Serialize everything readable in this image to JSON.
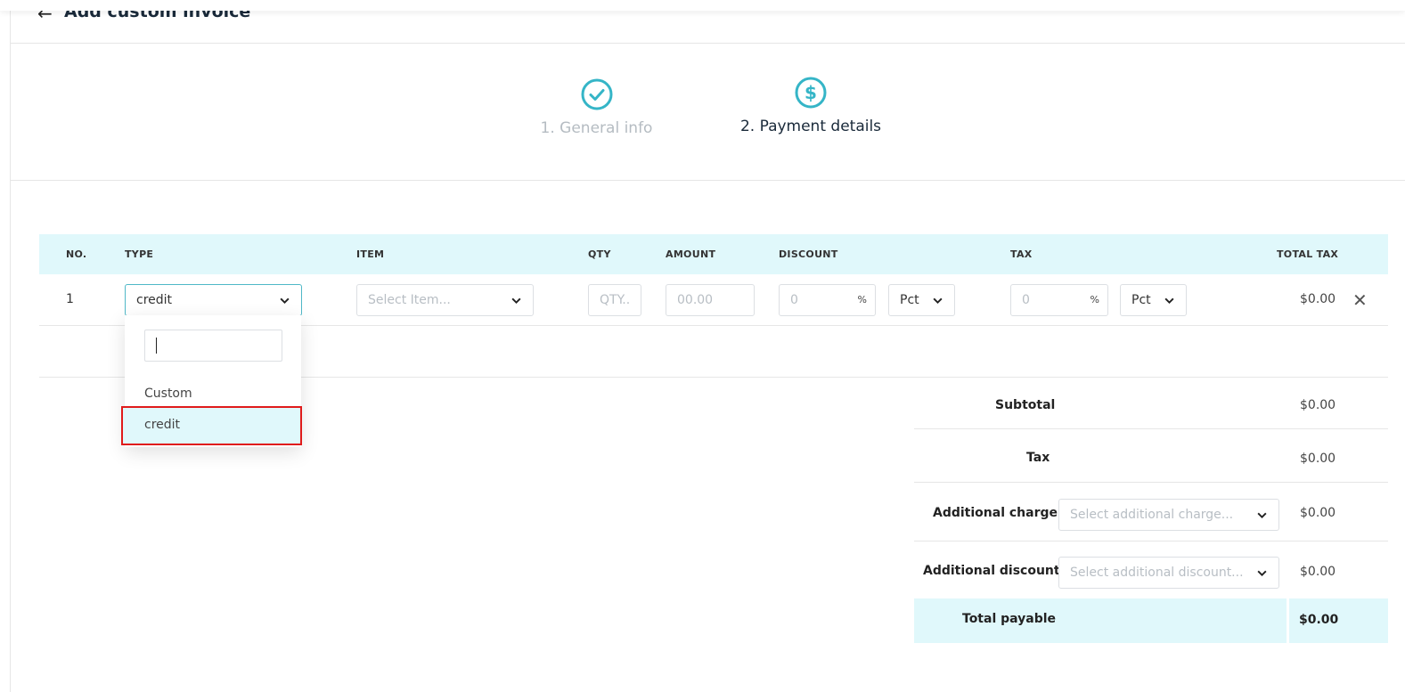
{
  "header": {
    "title": "Add custom invoice",
    "back_icon": "arrow-left-icon"
  },
  "steps": [
    {
      "label": "1. General info",
      "state": "done",
      "icon": "check-circle-icon"
    },
    {
      "label": "2. Payment details",
      "state": "active",
      "icon": "dollar-circle-icon"
    }
  ],
  "colors": {
    "accent": "#35b5c7",
    "table_header_bg": "#e0f8fb",
    "highlight_border": "#e01b1b"
  },
  "table": {
    "columns": [
      "NO.",
      "TYPE",
      "ITEM",
      "QTY",
      "AMOUNT",
      "DISCOUNT",
      "TAX",
      "TOTAL TAX"
    ],
    "row": {
      "no": "1",
      "type_value": "credit",
      "item_placeholder": "Select Item...",
      "qty_placeholder": "QTY..",
      "amount_placeholder": "00.00",
      "discount_value": "0",
      "discount_unit": "%",
      "discount_mode": "Pct",
      "tax_value": "0",
      "tax_unit": "%",
      "tax_mode": "Pct",
      "total_tax": "$0.00"
    }
  },
  "type_dropdown": {
    "search_value": "",
    "options": [
      "Custom",
      "credit"
    ],
    "selected": "credit"
  },
  "summary": {
    "subtotal_label": "Subtotal",
    "subtotal_value": "$0.00",
    "tax_label": "Tax",
    "tax_value": "$0.00",
    "additional_charge_label": "Additional charge",
    "additional_charge_placeholder": "Select additional charge...",
    "additional_charge_value": "$0.00",
    "additional_discount_label": "Additional discount",
    "additional_discount_placeholder": "Select additional discount...",
    "additional_discount_value": "$0.00",
    "total_label": "Total payable",
    "total_value": "$0.00"
  }
}
